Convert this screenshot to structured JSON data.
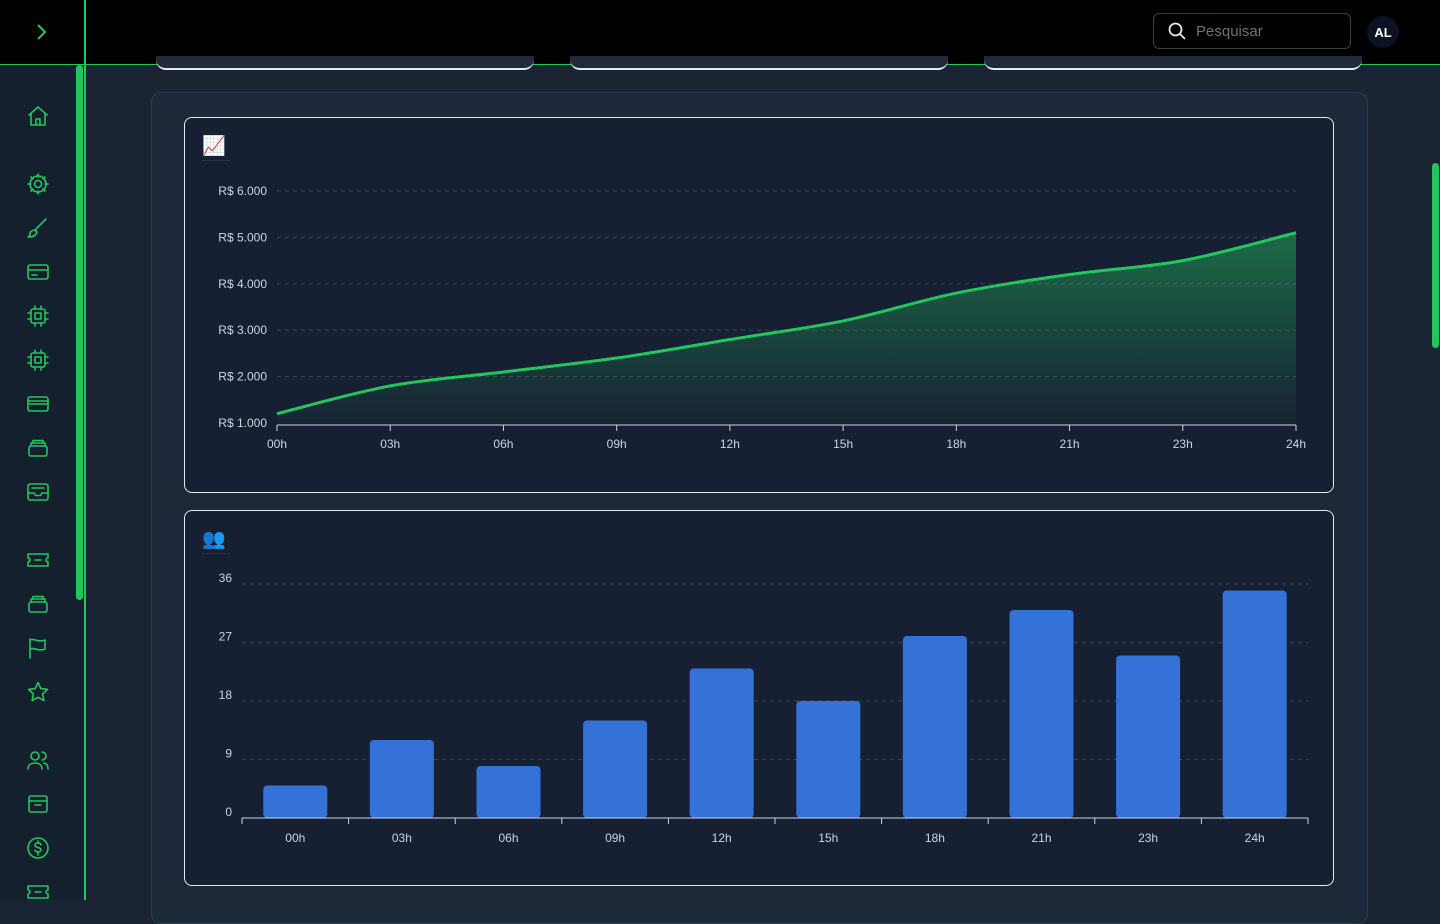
{
  "header": {
    "search_placeholder": "Pesquisar",
    "avatar_initials": "AL"
  },
  "sidebar": {
    "icons": [
      "home-icon",
      "settings-icon",
      "brush-icon",
      "credit-card-icon",
      "chip-icon",
      "chip-icon",
      "wallet-card-icon",
      "layers-icon",
      "inbox-icon",
      "ticket-icon",
      "layers-icon",
      "flag-icon",
      "star-icon",
      "users-icon",
      "archive-icon",
      "dollar-icon",
      "ticket-icon"
    ]
  },
  "colors": {
    "accent": "#22c55e",
    "bar": "#3572d8",
    "background": "#1b2433"
  },
  "charts": {
    "revenue_emoji": "📈",
    "users_emoji": "👥"
  },
  "chart_data": [
    {
      "type": "area",
      "x": [
        "00h",
        "03h",
        "06h",
        "09h",
        "12h",
        "15h",
        "18h",
        "21h",
        "23h",
        "24h"
      ],
      "y_ticks": [
        "R$ 1.000",
        "R$ 2.000",
        "R$ 3.000",
        "R$ 4.000",
        "R$ 5.000",
        "R$ 6.000"
      ],
      "ylim": [
        1000,
        6000
      ],
      "grid": true,
      "series": [
        {
          "values": [
            1200,
            1800,
            2100,
            2400,
            2800,
            3200,
            3800,
            4200,
            4500,
            5100
          ]
        }
      ]
    },
    {
      "type": "bar",
      "categories": [
        "00h",
        "03h",
        "06h",
        "09h",
        "12h",
        "15h",
        "18h",
        "21h",
        "23h",
        "24h"
      ],
      "y_ticks": [
        "0",
        "9",
        "18",
        "27",
        "36"
      ],
      "ylim": [
        0,
        36
      ],
      "grid": true,
      "values": [
        5,
        12,
        8,
        15,
        23,
        18,
        28,
        32,
        25,
        35
      ]
    }
  ]
}
